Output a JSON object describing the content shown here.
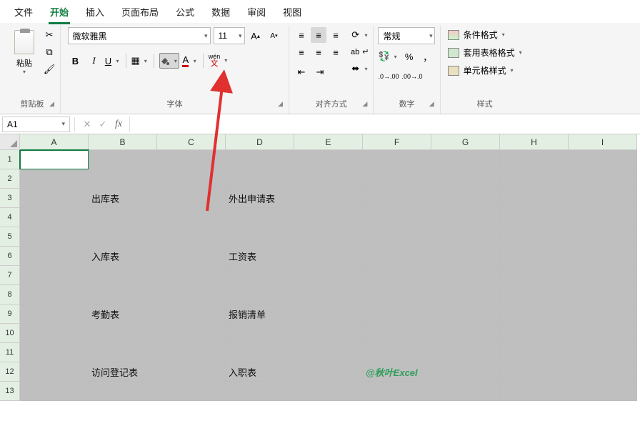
{
  "menu": {
    "tabs": [
      "文件",
      "开始",
      "插入",
      "页面布局",
      "公式",
      "数据",
      "审阅",
      "视图"
    ],
    "active": 1
  },
  "ribbon": {
    "clipboard": {
      "paste": "粘贴",
      "label": "剪贴板"
    },
    "font": {
      "name": "微软雅黑",
      "size": "11",
      "label": "字体",
      "bold": "B",
      "italic": "I",
      "underline": "U",
      "grow": "A",
      "shrink": "A",
      "fontcolor": "A",
      "wen": "wén",
      "wenSub": "文"
    },
    "align": {
      "label": "对齐方式",
      "wrap": "ab",
      "merge": "⬌"
    },
    "number": {
      "label": "数字",
      "format": "常规",
      "currency": "💱",
      "percent": "%",
      "comma": "，",
      "dec_inc": ".0 .00",
      "dec_dec": ".00 .0"
    },
    "styles": {
      "label": "样式",
      "cond": "条件格式",
      "table": "套用表格格式",
      "cell": "单元格样式"
    }
  },
  "formula_bar": {
    "ref": "A1"
  },
  "columns": [
    "A",
    "B",
    "C",
    "D",
    "E",
    "F",
    "G",
    "H",
    "I"
  ],
  "row_count": 13,
  "cells": {
    "B3": "出库表",
    "D3": "外出申请表",
    "B6": "入库表",
    "D6": "工资表",
    "B9": "考勤表",
    "D9": "报销清单",
    "B12": "访问登记表",
    "D12": "入职表",
    "F12": "@秋叶Excel"
  }
}
